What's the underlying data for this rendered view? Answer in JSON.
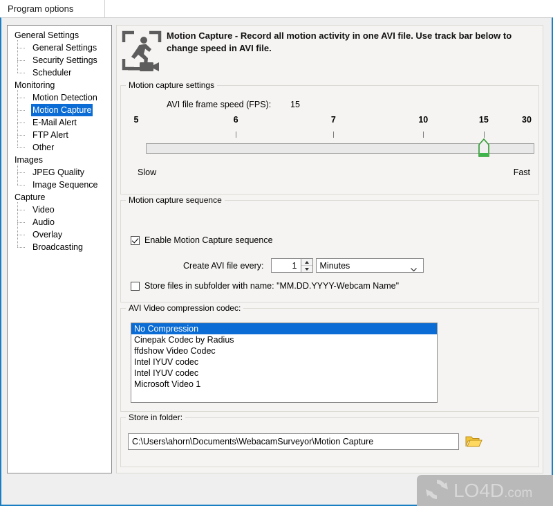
{
  "window": {
    "title": "Program options",
    "accent_border": "#1a7ec2",
    "selection_color": "#0a6cd4"
  },
  "sidebar": {
    "items": [
      {
        "label": "General Settings",
        "level": "root",
        "selected": false,
        "last": false
      },
      {
        "label": "General Settings",
        "level": "child",
        "selected": false,
        "last": false
      },
      {
        "label": "Security Settings",
        "level": "child",
        "selected": false,
        "last": false
      },
      {
        "label": "Scheduler",
        "level": "child",
        "selected": false,
        "last": true
      },
      {
        "label": "Monitoring",
        "level": "root",
        "selected": false,
        "last": false
      },
      {
        "label": "Motion Detection",
        "level": "child",
        "selected": false,
        "last": false
      },
      {
        "label": "Motion Capture",
        "level": "child",
        "selected": true,
        "last": false
      },
      {
        "label": "E-Mail Alert",
        "level": "child",
        "selected": false,
        "last": false
      },
      {
        "label": "FTP Alert",
        "level": "child",
        "selected": false,
        "last": false
      },
      {
        "label": "Other",
        "level": "child",
        "selected": false,
        "last": true
      },
      {
        "label": "Images",
        "level": "root",
        "selected": false,
        "last": false
      },
      {
        "label": "JPEG Quality",
        "level": "child",
        "selected": false,
        "last": false
      },
      {
        "label": "Image Sequence",
        "level": "child",
        "selected": false,
        "last": true
      },
      {
        "label": "Capture",
        "level": "root",
        "selected": false,
        "last": false
      },
      {
        "label": "Video",
        "level": "child",
        "selected": false,
        "last": false
      },
      {
        "label": "Audio",
        "level": "child",
        "selected": false,
        "last": false
      },
      {
        "label": "Overlay",
        "level": "child",
        "selected": false,
        "last": false
      },
      {
        "label": "Broadcasting",
        "level": "child",
        "selected": false,
        "last": true
      }
    ]
  },
  "header": {
    "icon": "motion-capture-icon",
    "heading": "Motion Capture - Record all motion activity in one AVI file. Use track bar below to change speed in AVI file."
  },
  "settings_group": {
    "legend": "Motion capture settings",
    "fps_caption": "AVI file frame speed (FPS):",
    "fps_value": "15",
    "slow_label": "Slow",
    "fast_label": "Fast",
    "slider": {
      "ticks": [
        "5",
        "6",
        "7",
        "10",
        "15",
        "30"
      ],
      "tick_positions_pct": [
        0,
        25.5,
        50.5,
        73.5,
        89,
        100
      ],
      "thumb_position_pct": 89,
      "current": "15"
    }
  },
  "sequence_group": {
    "legend": "Motion capture sequence",
    "enable_label": "Enable Motion Capture sequence",
    "enable_checked": true,
    "interval_caption": "Create AVI file every:",
    "interval_value": "1",
    "interval_unit": "Minutes",
    "subfolder_label": "Store files in subfolder with name: \"MM.DD.YYYY-Webcam Name\"",
    "subfolder_checked": false
  },
  "codec_group": {
    "legend": "AVI Video compression codec:",
    "items": [
      "No Compression",
      "Cinepak Codec by Radius",
      "ffdshow Video Codec",
      "Intel IYUV codec",
      "Intel IYUV codec",
      "Microsoft Video 1"
    ],
    "selected_index": 0
  },
  "folder_group": {
    "legend": "Store in folder:",
    "path": "C:\\Users\\ahorn\\Documents\\WebacamSurveyor\\Motion Capture",
    "browse_icon": "folder-open-icon"
  },
  "watermark": {
    "text": "LO4D",
    "domain": ".com",
    "icon": "refresh-arrows-icon"
  }
}
